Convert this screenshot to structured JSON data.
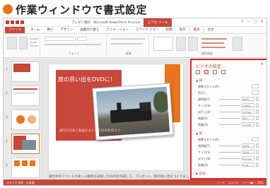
{
  "heading": {
    "text": "作業ウィンドウで書式設定"
  },
  "window": {
    "title": "プレゼン資料 - Microsoft PowerPoint Preview",
    "context_tab_group": "ビデオ ツール",
    "controls": [
      "?",
      "—",
      "□",
      "✕"
    ]
  },
  "ribbon": {
    "tabs": [
      {
        "label": "ファイル",
        "kind": "file"
      },
      {
        "label": "ホーム"
      },
      {
        "label": "挿入"
      },
      {
        "label": "デザイン"
      },
      {
        "label": "画面切り替え"
      },
      {
        "label": "アニメーション"
      },
      {
        "label": "スライド ショー"
      },
      {
        "label": "校閲"
      },
      {
        "label": "表示"
      },
      {
        "label": "書式",
        "kind": "ctx-active"
      },
      {
        "label": "再生",
        "kind": "ctx"
      }
    ],
    "group_labels": [
      "フォント",
      "段落",
      "図形描画"
    ]
  },
  "slide": {
    "title": "旅の思い出をDVDに！",
    "subtitle": "旅行の写真と動画をまとめてDVDを作ろう",
    "notes": "旅行中のイベントや楽しい風景を記録したDVDを作成して、プレゼント。旅の思い出をつくりましょう"
  },
  "thumbnails": [
    {
      "num": "1"
    },
    {
      "num": "2"
    },
    {
      "num": "3"
    },
    {
      "num": "4"
    },
    {
      "num": "5"
    }
  ],
  "pane": {
    "title": "ビデオの設定",
    "close": "✕",
    "section1": "▲ 線",
    "section2": "▲ 影",
    "section3": "▶ 反射",
    "rows1": [
      {
        "label": "標準スタイル(P)",
        "value": ""
      },
      {
        "label": "色(C)",
        "value": ""
      },
      {
        "label": "透明度(T)",
        "value": "60%"
      },
      {
        "label": "サイズ(S)",
        "value": "100%"
      },
      {
        "label": "ぼかし(B)",
        "value": "4.5 pt"
      },
      {
        "label": "角度(A)",
        "value": "90°"
      },
      {
        "label": "距離(D)",
        "value": "1.4 pt"
      }
    ],
    "rows2": [
      {
        "label": "標準スタイル(P)",
        "value": ""
      },
      {
        "label": "透明度(T)",
        "value": "60%"
      },
      {
        "label": "サイズ(S)",
        "value": "35%"
      },
      {
        "label": "ぼかし(B)",
        "value": "0.5 pt"
      },
      {
        "label": "距離(D)",
        "value": "0 pt"
      }
    ]
  },
  "status": {
    "left": "スライド 4/8　日本語",
    "right": "ノート　コメント　─────●── 56%"
  }
}
